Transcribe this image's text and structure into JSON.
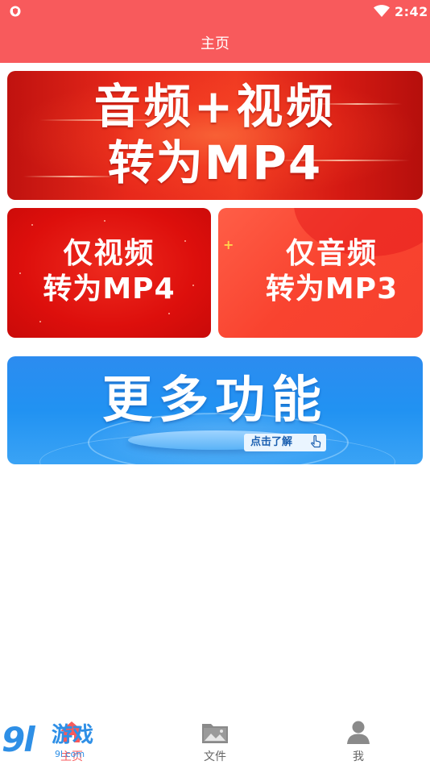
{
  "status_bar": {
    "time": "2:42"
  },
  "header": {
    "title": "主页"
  },
  "banners": {
    "main": {
      "line1": "音频+视频",
      "line2": "转为MP4"
    },
    "video_only": {
      "line1": "仅视频",
      "line2": "转为MP4"
    },
    "audio_only": {
      "line1": "仅音频",
      "line2": "转为MP3"
    },
    "more": {
      "title": "更多功能",
      "cta": "点击了解"
    }
  },
  "tabs": [
    {
      "label": "主页",
      "icon": "home-icon",
      "active": true
    },
    {
      "label": "文件",
      "icon": "image-folder-icon",
      "active": false
    },
    {
      "label": "我",
      "icon": "person-icon",
      "active": false
    }
  ],
  "watermark": {
    "number": "9l",
    "text": "游戏",
    "site": "9l.com"
  },
  "colors": {
    "header_bg": "#f85a5c",
    "banner_main": "#e8291b",
    "banner_video": "#dd0f0c",
    "banner_audio": "#f9432f",
    "banner_more": "#2192f2",
    "tab_active": "#f85a5c",
    "tab_inactive": "#666666",
    "watermark": "#2e8fe6"
  }
}
